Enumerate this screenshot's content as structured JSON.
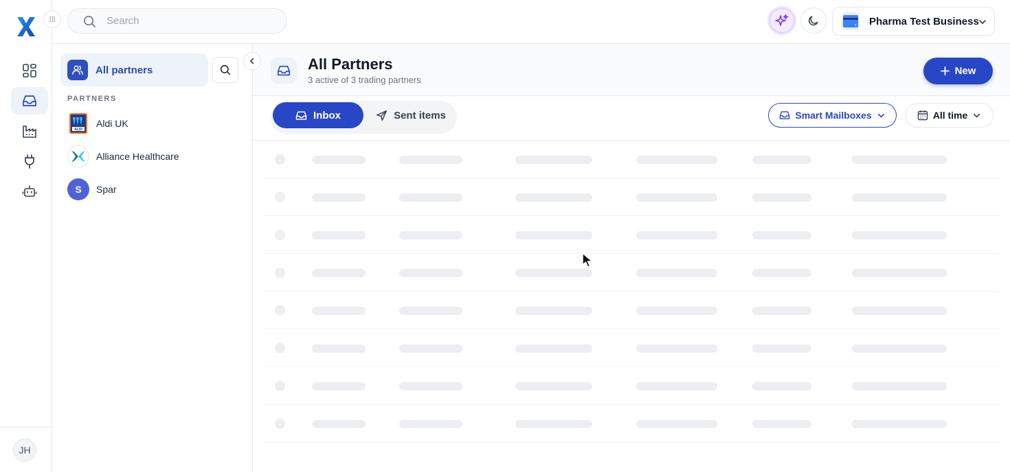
{
  "app": {
    "logo": "x-logo",
    "rail_items": [
      {
        "name": "dashboard-icon",
        "active": false
      },
      {
        "name": "inbox-icon",
        "active": true
      },
      {
        "name": "factory-icon",
        "active": false
      },
      {
        "name": "plug-icon",
        "active": false
      },
      {
        "name": "robot-icon",
        "active": false
      }
    ],
    "user_initials": "JH"
  },
  "topbar": {
    "search_placeholder": "Search",
    "business_name": "Pharma Test Business"
  },
  "partners_panel": {
    "all_partners_label": "All partners",
    "section_label": "PARTNERS",
    "partners": [
      {
        "name": "Aldi UK",
        "logo": "aldi-logo"
      },
      {
        "name": "Alliance Healthcare",
        "logo": "alliance-logo"
      },
      {
        "name": "Spar",
        "logo": "letter-avatar",
        "initial": "S"
      }
    ]
  },
  "main": {
    "title": "All Partners",
    "subtitle": "3 active of 3 trading partners",
    "new_button": "New",
    "tabs": {
      "inbox": "Inbox",
      "sent": "Sent items",
      "active": "inbox"
    },
    "smart_mailboxes": "Smart Mailboxes",
    "time_filter": "All time",
    "loading_rows": 8
  },
  "colors": {
    "primary": "#2747c6",
    "accent_purple": "#7c3aed",
    "border": "#e5e7eb"
  }
}
